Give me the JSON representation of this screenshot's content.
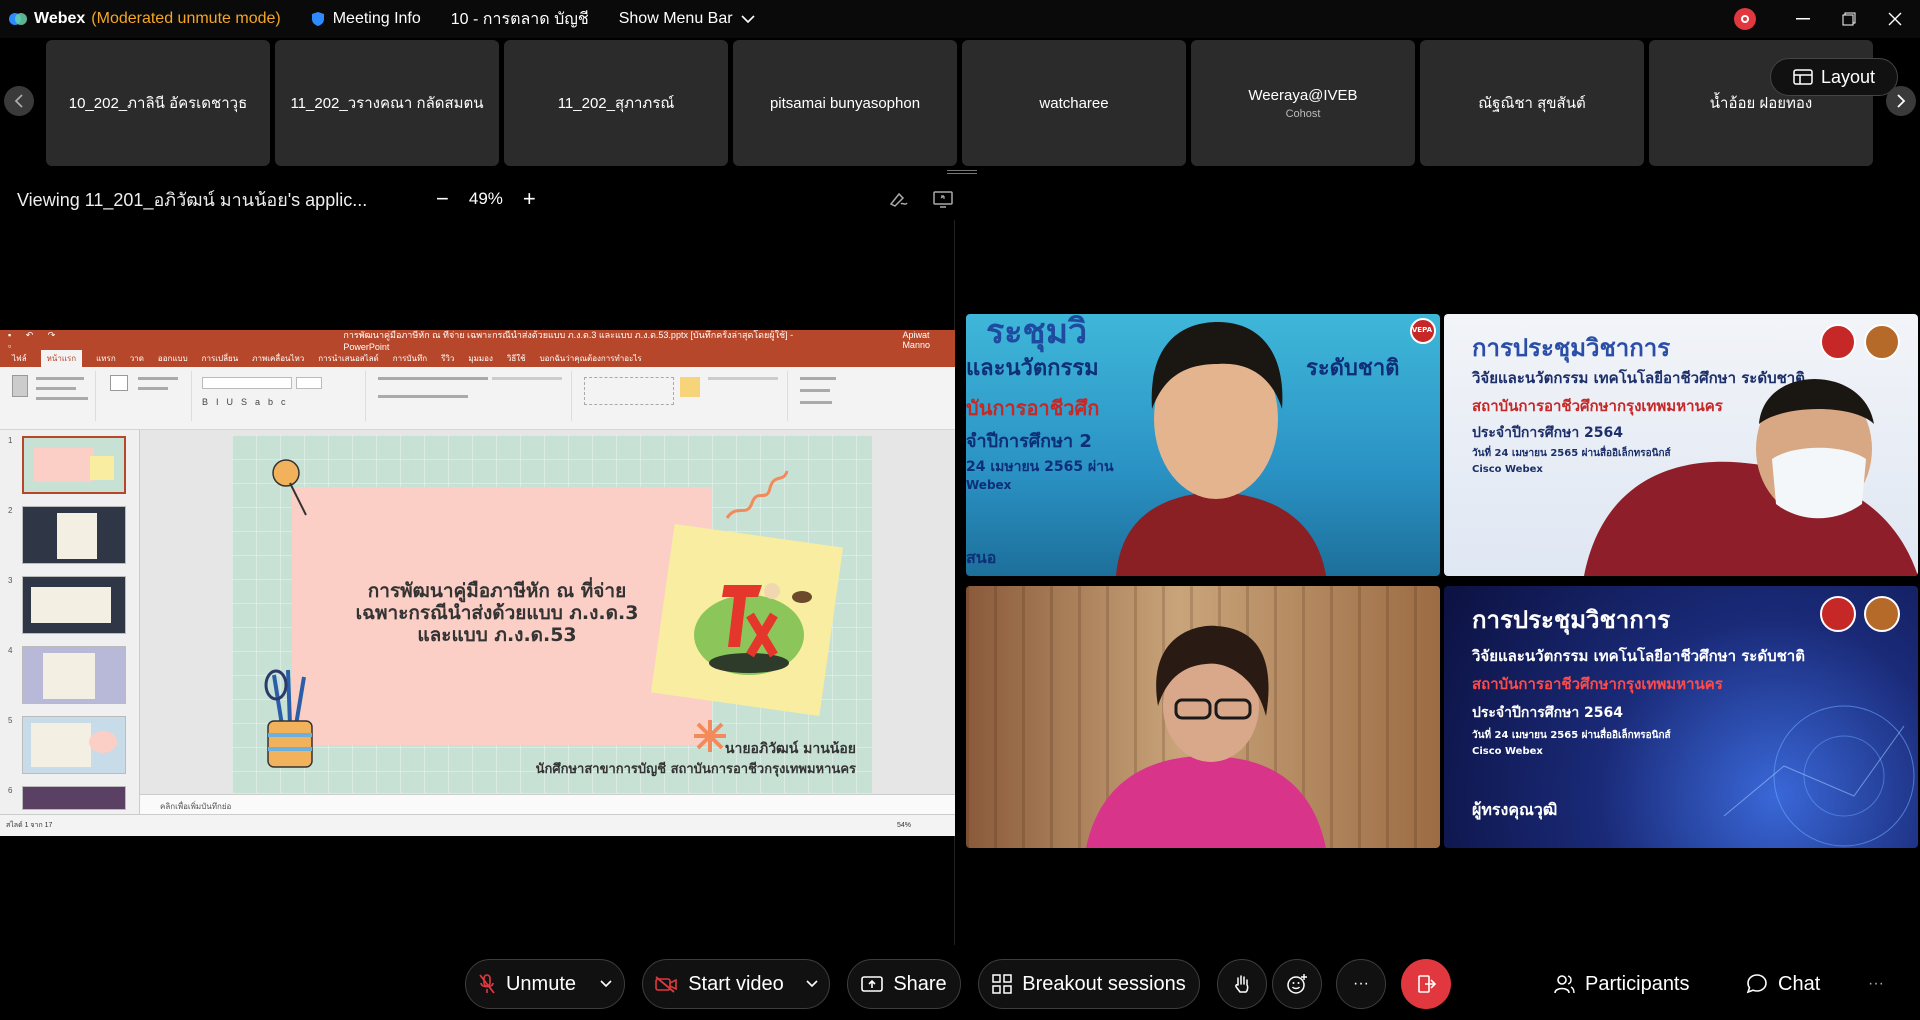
{
  "titlebar": {
    "app_name": "Webex",
    "mode": "(Moderated unmute mode)",
    "meeting_info": "Meeting Info",
    "meeting_name": "10 - การตลาด บัญชี",
    "show_menu": "Show Menu Bar"
  },
  "participants": [
    {
      "name": "10_202_ภาลินี อัครเดชาวุธ",
      "role": ""
    },
    {
      "name": "11_202_วรางคณา กลัดสมตน",
      "role": ""
    },
    {
      "name": "11_202_สุภาภรณ์",
      "role": ""
    },
    {
      "name": "pitsamai bunyasophon",
      "role": ""
    },
    {
      "name": "watcharee",
      "role": ""
    },
    {
      "name": "Weeraya@IVEB",
      "role": "Cohost"
    },
    {
      "name": "ณัฐณิชา สุขสันต์",
      "role": ""
    },
    {
      "name": "น้ำอ้อย ฝอยทอง",
      "role": ""
    }
  ],
  "layout_label": "Layout",
  "share": {
    "viewing": "Viewing 11_201_อภิวัฒน์ มานน้อย's applic...",
    "zoom": "49%",
    "zoom_out": "−",
    "zoom_in": "+"
  },
  "ppt": {
    "window_title": "การพัฒนาคู่มือภาษีหัก ณ ที่จ่าย เฉพาะกรณีนำส่งด้วยแบบ ภ.ง.ด.3 และแบบ ภ.ง.ด.53.pptx [บันทึกครั้งล่าสุดโดยผู้ใช้] - PowerPoint",
    "user": "Apiwat Manno",
    "tabs": [
      "ไฟล์",
      "หน้าแรก",
      "แทรก",
      "วาด",
      "ออกแบบ",
      "การเปลี่ยน",
      "ภาพเคลื่อนไหว",
      "การนำเสนอสไลด์",
      "การบันทึก",
      "รีวิว",
      "มุมมอง",
      "วิธีใช้",
      "บอกฉันว่าคุณต้องการทำอะไร"
    ],
    "thumb_numbers": [
      "1",
      "2",
      "3",
      "4",
      "5",
      "6"
    ],
    "slide_title_1": "การพัฒนาคู่มือภาษีหัก ณ ที่จ่าย",
    "slide_title_2": "เฉพาะกรณีนำส่งด้วยแบบ ภ.ง.ด.3",
    "slide_title_3": "และแบบ ภ.ง.ด.53",
    "author": "นายอภิวัฒน์ มานน้อย",
    "institution": "นักศึกษาสาขาการบัญชี สถาบันการอาชีวกรุงเทพมหานคร",
    "notes": "คลิกเพื่อเพิ่มบันทึกย่อ",
    "status_slide": "สไลด์ 1 จาก 17",
    "status_zoom": "54%"
  },
  "videos": {
    "banner_title": "การประชุมวิชาการ",
    "banner_line2": "วิจัยและนวัตกรรม เทคโนโลยีอาชีวศึกษา ระดับชาติ",
    "banner_org": "สถาบันการอาชีวศึกษากรุงเทพมหานคร",
    "banner_year": "ประจำปีการศึกษา 2564",
    "banner_date": "วันที่ 24 เมษายน 2565 ผ่านสื่ออิเล็กทรอนิกส์",
    "banner_platform": "Cisco Webex",
    "banner_honor": "ผู้ทรงคุณวุฒิ",
    "tile1_text_a": "ระชุมวิ",
    "tile1_text_b": "และนวัตกรรม",
    "tile1_text_c": "ระดับชาติ",
    "tile1_text_d": "บันการอาชีวศึก",
    "tile1_text_e": "จำปีการศึกษา 2",
    "tile1_text_f": "24 เมษายน 2565 ผ่าน",
    "tile1_text_g": "Webex",
    "tile1_text_h": "สนอ",
    "vepa": "VEPA"
  },
  "toolbar": {
    "unmute": "Unmute",
    "start_video": "Start video",
    "share": "Share",
    "breakout": "Breakout sessions",
    "participants": "Participants",
    "chat": "Chat",
    "more": "···"
  },
  "colors": {
    "accent_orange": "#f5a623",
    "leave_red": "#e0383e",
    "ppt_red": "#b7472a"
  }
}
